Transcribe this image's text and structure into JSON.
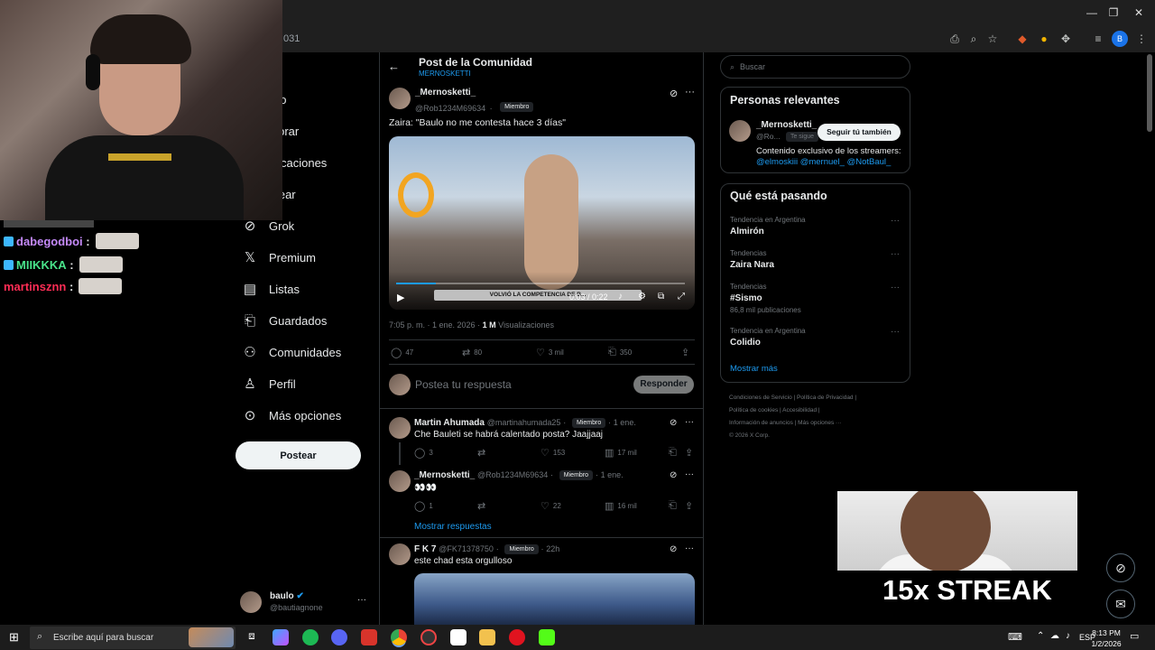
{
  "browser": {
    "url_fragment": "031",
    "window_buttons": [
      "—",
      "❐",
      "✕"
    ]
  },
  "nav": {
    "items": [
      {
        "label": "icio",
        "icon": "home-icon"
      },
      {
        "label": "plorar",
        "icon": "search-icon"
      },
      {
        "label": "tificaciones",
        "icon": "bell-icon"
      },
      {
        "label": "atear",
        "icon": "mail-icon"
      },
      {
        "label": "Grok",
        "icon": "grok-icon"
      },
      {
        "label": "Premium",
        "icon": "x-logo-icon"
      },
      {
        "label": "Listas",
        "icon": "list-icon"
      },
      {
        "label": "Guardados",
        "icon": "bookmark-icon"
      },
      {
        "label": "Comunidades",
        "icon": "people-icon"
      },
      {
        "label": "Perfil",
        "icon": "person-icon"
      },
      {
        "label": "Más opciones",
        "icon": "more-circle-icon"
      }
    ],
    "post_button": "Postear",
    "account": {
      "name": "baulo",
      "handle": "@bautiagnone",
      "more": "···"
    }
  },
  "chat": [
    {
      "user": "dabegodboi",
      "color": "#c58af9",
      "badge": "#3db7ff"
    },
    {
      "user": "MIIKKKA",
      "color": "#49e38a",
      "badge": "#3db7ff"
    },
    {
      "user": "martinsznn",
      "color": "#ff2d55",
      "badge": ""
    }
  ],
  "post": {
    "header_title": "Post de la Comunidad",
    "header_sub": "MERNOSKETTI",
    "author": "_Mernosketti_",
    "handle": "@Rob1234M69634",
    "dot": "·",
    "badge": "Miembro",
    "text": "Zaira: \"Baulo no me contesta hace 3 días\"",
    "video_time": "0:03 / 0:22",
    "video_caption": "VOLVIÓ LA COMPETENCIA DE B...",
    "timestamp": "7:05 p. m. · 1 ene. 2026 ·",
    "views_count": "1 M",
    "views_label": "Visualizaciones",
    "stats": {
      "replies": "47",
      "reposts": "80",
      "likes": "3 mil",
      "bookmarks": "350"
    },
    "reply_placeholder": "Postea tu respuesta",
    "reply_button": "Responder"
  },
  "replies": [
    {
      "author": "Martin Ahumada",
      "handle": "@martinahumada25",
      "badge": "Miembro",
      "time": "1 ene.",
      "text": "Che Bauleti se habrá calentado posta? Jaajjaaj",
      "replies": "3",
      "reposts": "",
      "likes": "153",
      "views": "17 mil"
    },
    {
      "author": "_Mernosketti_",
      "handle": "@Rob1234M69634",
      "badge": "Miembro",
      "time": "1 ene.",
      "text": "👀👀",
      "replies": "1",
      "reposts": "",
      "likes": "22",
      "views": "16 mil"
    },
    {
      "author": "F K 7",
      "handle": "@FK71378750",
      "badge": "Miembro",
      "time": "22h",
      "text": "este chad esta orgulloso",
      "replies": "",
      "reposts": "",
      "likes": "",
      "views": ""
    }
  ],
  "show_replies": "Mostrar respuestas",
  "right": {
    "search_placeholder": "Buscar",
    "relevant_title": "Personas relevantes",
    "relevant_name": "_Mernosketti_",
    "relevant_handle": "@Ro...",
    "relevant_follows": "Te sigue",
    "follow_button": "Seguir tú también",
    "relevant_bio": "Contenido exclusivo de los streamers:",
    "relevant_links": "@elmoskiii @mernuel_ @NotBaul_",
    "trending_title": "Qué está pasando",
    "trends": [
      {
        "category": "Tendencia en Argentina",
        "name": "Almirón",
        "posts": ""
      },
      {
        "category": "Tendencias",
        "name": "Zaira Nara",
        "posts": ""
      },
      {
        "category": "Tendencias",
        "name": "#Sismo",
        "posts": "86,8 mil publicaciones"
      },
      {
        "category": "Tendencia en Argentina",
        "name": "Colidio",
        "posts": ""
      }
    ],
    "show_more": "Mostrar más",
    "footer": [
      "Condiciones de Servicio",
      "Política de Privacidad",
      "Política de cookies",
      "Accesibilidad",
      "Información de anuncios",
      "Más opciones ···",
      "© 2026 X Corp."
    ]
  },
  "overlay": {
    "streak": "15x STREAK"
  },
  "taskbar": {
    "search_placeholder": "Escribe aquí para buscar",
    "lang": "ESP",
    "time": "8:13 PM",
    "date": "1/2/2026"
  },
  "colors": {
    "accent": "#1d9bf0",
    "border": "#2f3336",
    "muted": "#71767b"
  }
}
